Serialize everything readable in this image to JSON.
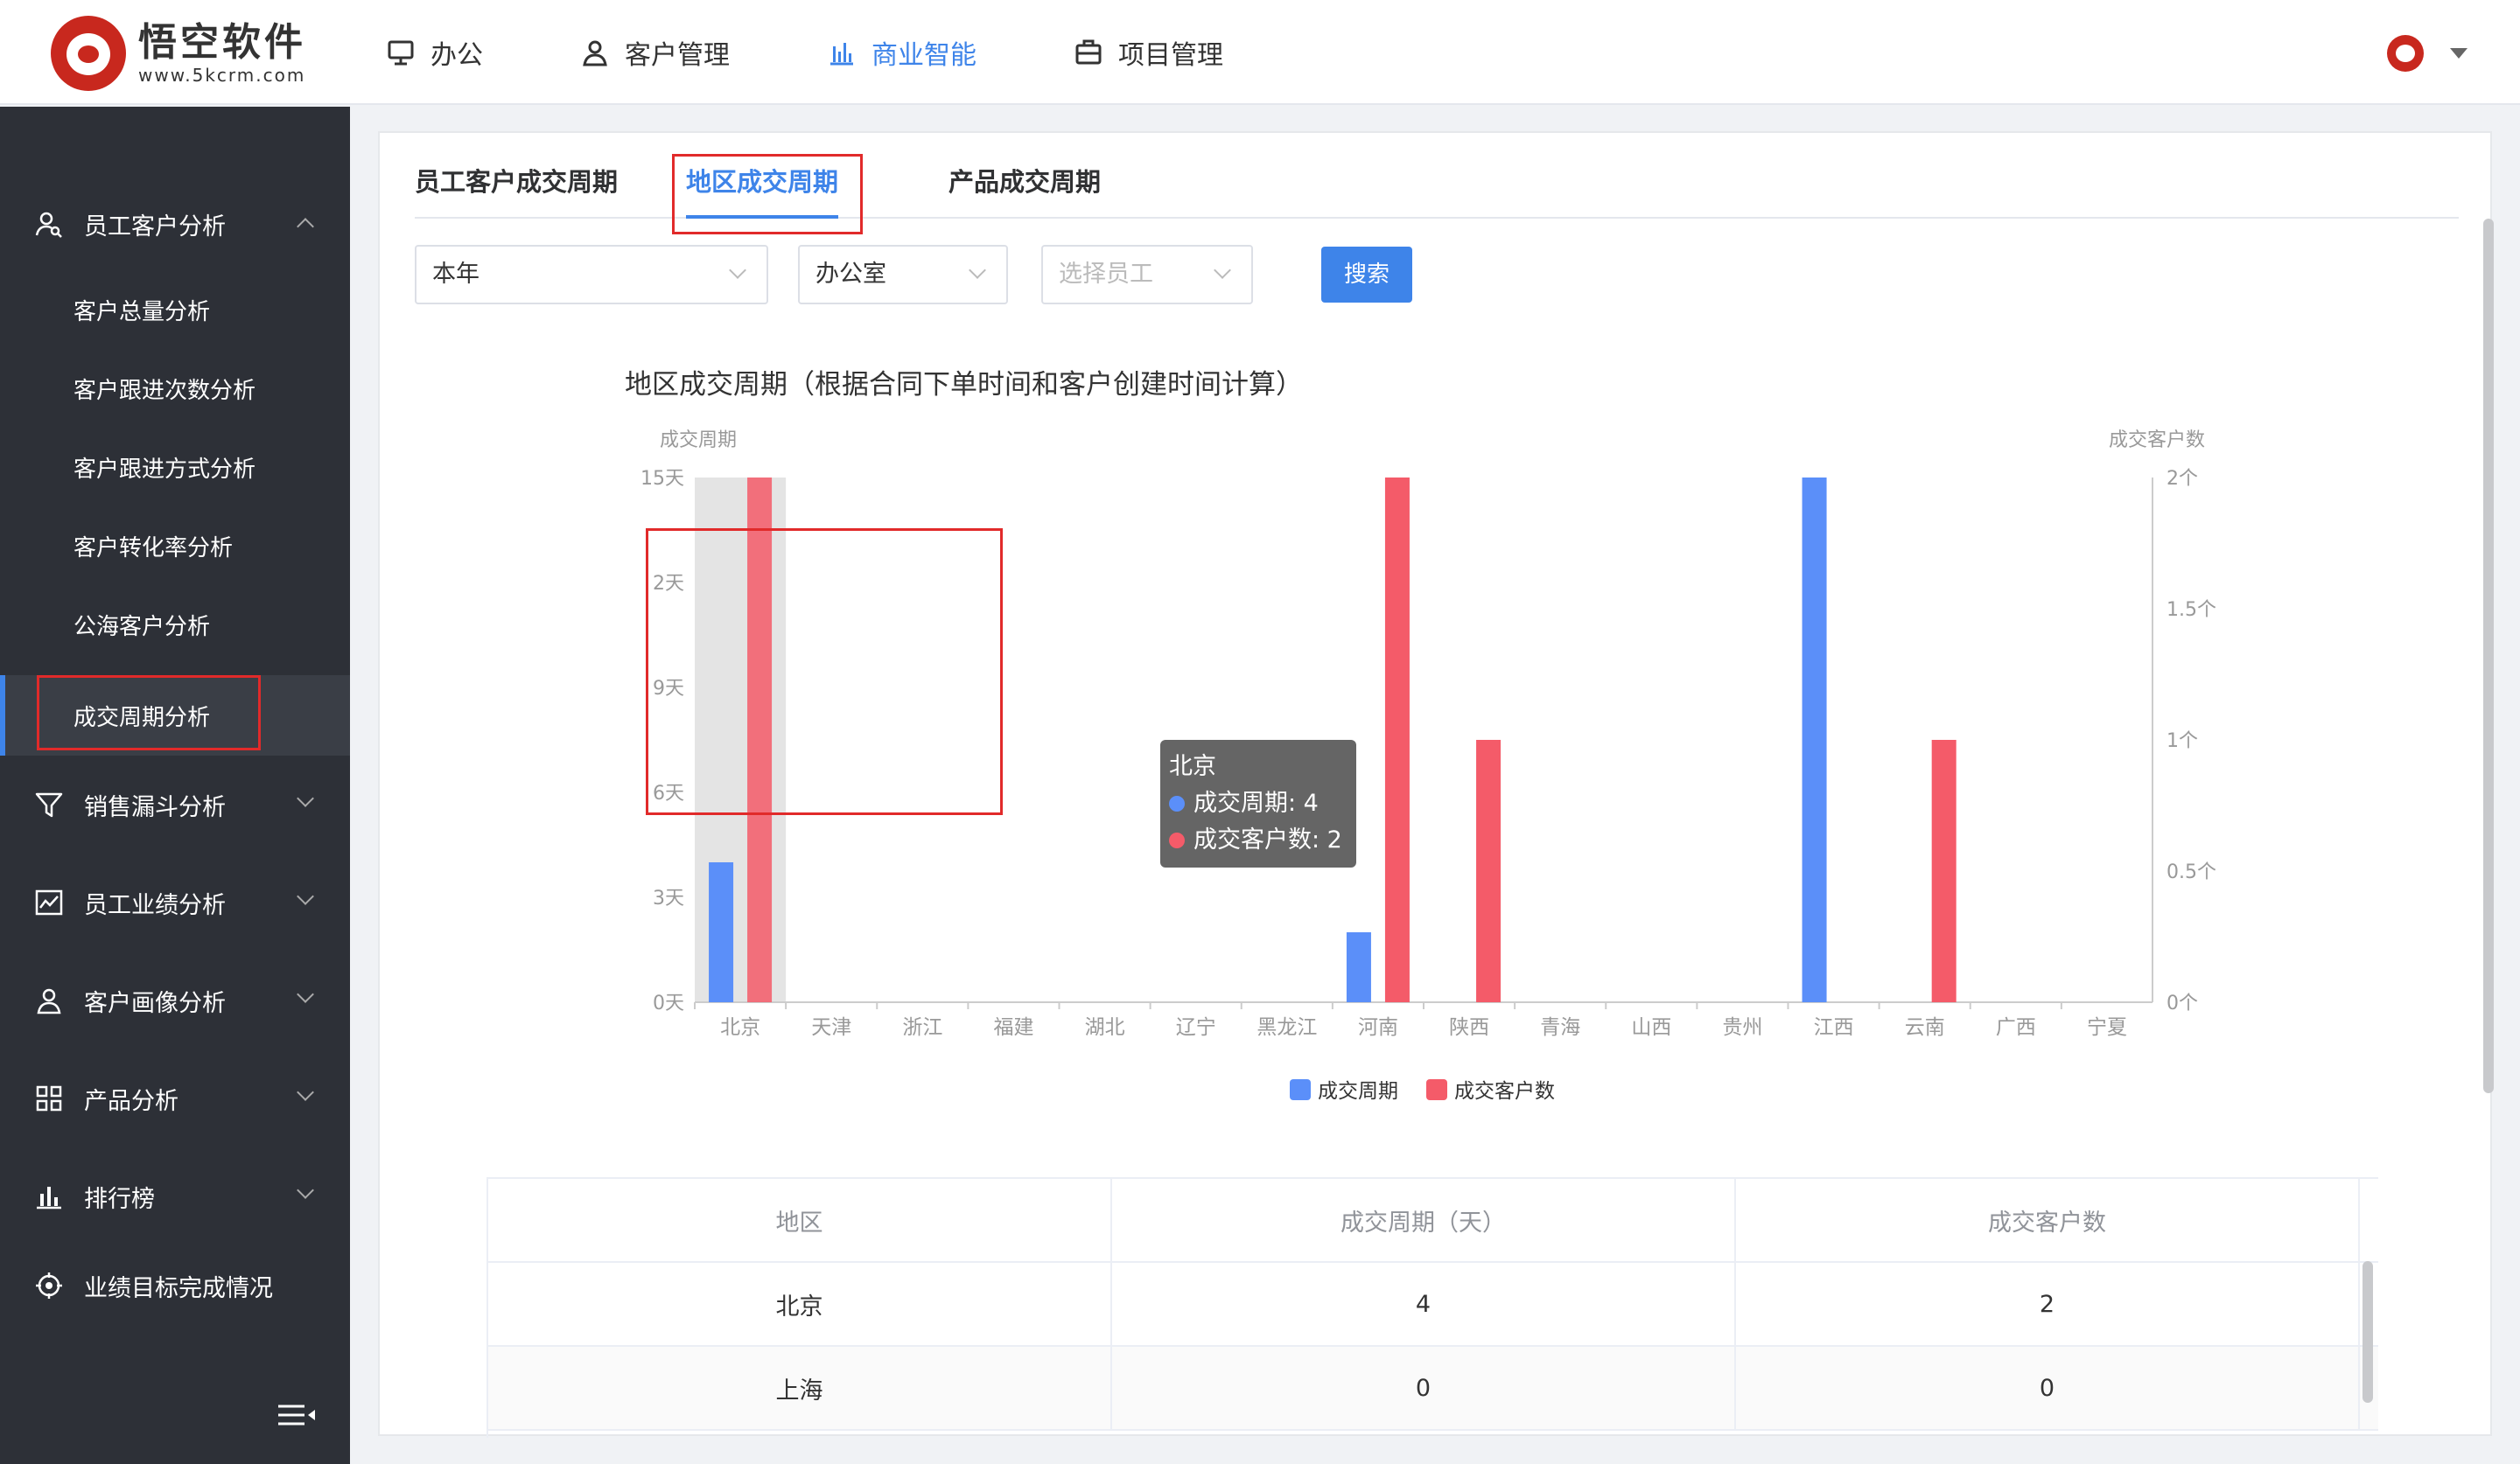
{
  "header": {
    "logo_name": "悟空软件",
    "logo_url": "www.5kcrm.com",
    "nav": [
      {
        "label": "办公",
        "icon": "monitor-icon"
      },
      {
        "label": "客户管理",
        "icon": "user-icon"
      },
      {
        "label": "商业智能",
        "icon": "bar-chart-icon",
        "active": true
      },
      {
        "label": "项目管理",
        "icon": "briefcase-icon"
      }
    ]
  },
  "sidebar": {
    "groups": [
      {
        "label": "员工客户分析",
        "icon": "user-search-icon",
        "expanded": true
      },
      {
        "label": "销售漏斗分析",
        "icon": "funnel-icon"
      },
      {
        "label": "员工业绩分析",
        "icon": "line-chart-icon"
      },
      {
        "label": "客户画像分析",
        "icon": "user-icon"
      },
      {
        "label": "产品分析",
        "icon": "grid-icon"
      },
      {
        "label": "排行榜",
        "icon": "bar-chart-icon"
      },
      {
        "label": "业绩目标完成情况",
        "icon": "target-icon"
      }
    ],
    "sub_items": [
      "客户总量分析",
      "客户跟进次数分析",
      "客户跟进方式分析",
      "客户转化率分析",
      "公海客户分析",
      "成交周期分析"
    ],
    "active_sub": "成交周期分析"
  },
  "tabs": [
    "员工客户成交周期",
    "地区成交周期",
    "产品成交周期"
  ],
  "filters": {
    "period": "本年",
    "department": "办公室",
    "employee_placeholder": "选择员工",
    "search_label": "搜索"
  },
  "chart_data": {
    "type": "bar",
    "title": "地区成交周期（根据合同下单时间和客户创建时间计算）",
    "ylabel_left": "成交周期",
    "ylabel_right": "成交客户数",
    "left_ticks": [
      "0天",
      "3天",
      "6天",
      "9天",
      "2天",
      "15天"
    ],
    "right_ticks": [
      "0个",
      "0.5个",
      "1个",
      "1.5个",
      "2个"
    ],
    "ylim_left": [
      0,
      15
    ],
    "ylim_right": [
      0,
      2
    ],
    "categories": [
      "北京",
      "天津",
      "浙江",
      "福建",
      "湖北",
      "辽宁",
      "黑龙江",
      "河南",
      "陕西",
      "青海",
      "山西",
      "贵州",
      "江西",
      "云南",
      "广西",
      "宁夏"
    ],
    "series": [
      {
        "name": "成交周期",
        "axis": "left",
        "color": "#5b8ff9",
        "values": [
          4,
          0,
          0,
          0,
          0,
          0,
          0,
          2,
          0,
          0,
          0,
          0,
          15,
          0,
          0,
          0
        ]
      },
      {
        "name": "成交客户数",
        "axis": "right",
        "color": "#f45b69",
        "values": [
          2,
          0,
          0,
          0,
          0,
          0,
          0,
          2,
          1,
          0,
          0,
          0,
          0,
          1,
          0,
          0
        ]
      }
    ],
    "legend": "bottom-center",
    "grid": false,
    "tooltip": {
      "title": "北京",
      "line1": "成交周期: 4",
      "line2": "成交客户数: 2"
    }
  },
  "table": {
    "headers": [
      "地区",
      "成交周期（天）",
      "成交客户数"
    ],
    "rows": [
      [
        "北京",
        "4",
        "2"
      ],
      [
        "上海",
        "0",
        "0"
      ]
    ]
  }
}
